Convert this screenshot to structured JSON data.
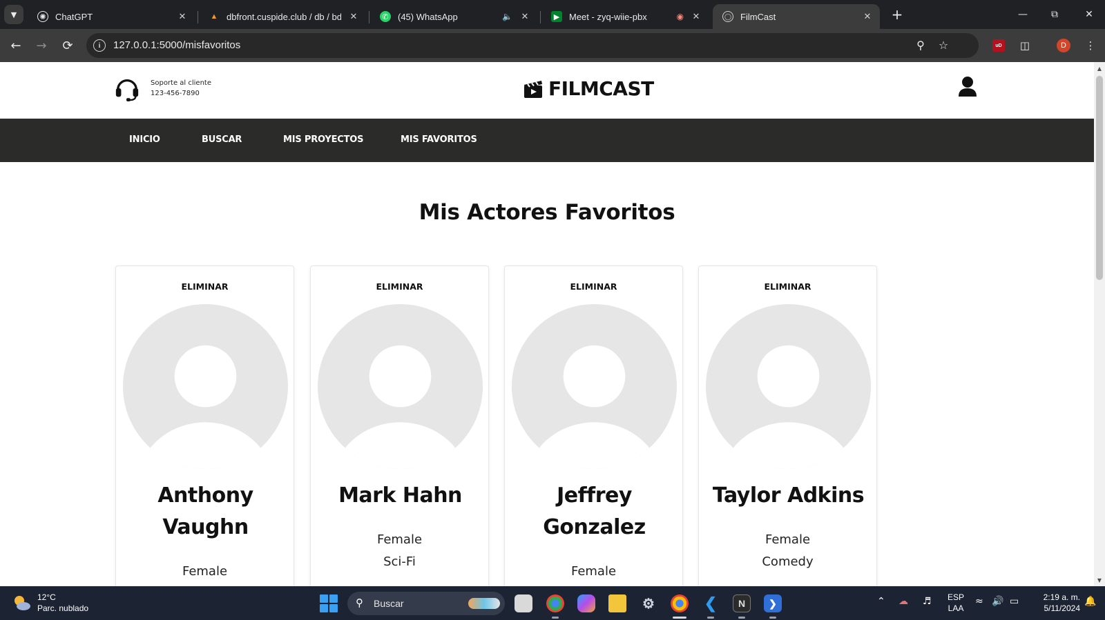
{
  "browser": {
    "tabs": [
      {
        "title": "ChatGPT",
        "icon": "chatgpt-icon"
      },
      {
        "title": "dbfront.cuspide.club / db / bdd",
        "icon": "dbfront-icon"
      },
      {
        "title": "(45) WhatsApp",
        "icon": "whatsapp-icon"
      },
      {
        "title": "Meet - zyq-wiie-pbx",
        "icon": "meet-icon"
      },
      {
        "title": "FilmCast",
        "icon": "globe-icon",
        "active": true
      }
    ],
    "url": "127.0.0.1:5000/misfavoritos",
    "profile_initial": "D",
    "extension_badge": "uD"
  },
  "site": {
    "support_label": "Soporte al cliente",
    "support_phone": "123-456-7890",
    "brand": "FILMCAST",
    "nav": [
      "INICIO",
      "BUSCAR",
      "MIS PROYECTOS",
      "MIS FAVORITOS"
    ]
  },
  "page": {
    "title": "Mis Actores Favoritos",
    "remove_label": "ELIMINAR",
    "actors": [
      {
        "name": "Anthony Vaughn",
        "gender": "Female",
        "genre": ""
      },
      {
        "name": "Mark Hahn",
        "gender": "Female",
        "genre": "Sci-Fi"
      },
      {
        "name": "Jeffrey Gonzalez",
        "gender": "Female",
        "genre": ""
      },
      {
        "name": "Taylor Adkins",
        "gender": "Female",
        "genre": "Comedy"
      }
    ]
  },
  "taskbar": {
    "weather_temp": "12°C",
    "weather_desc": "Parc. nublado",
    "search_label": "Buscar",
    "lang_top": "ESP",
    "lang_bottom": "LAA",
    "time": "2:19 a. m.",
    "date": "5/11/2024"
  },
  "colors": {
    "navbar_bg": "#2b2b29",
    "avatar_placeholder": "#e6e6e6",
    "taskbar_bg": "#1c2333"
  }
}
